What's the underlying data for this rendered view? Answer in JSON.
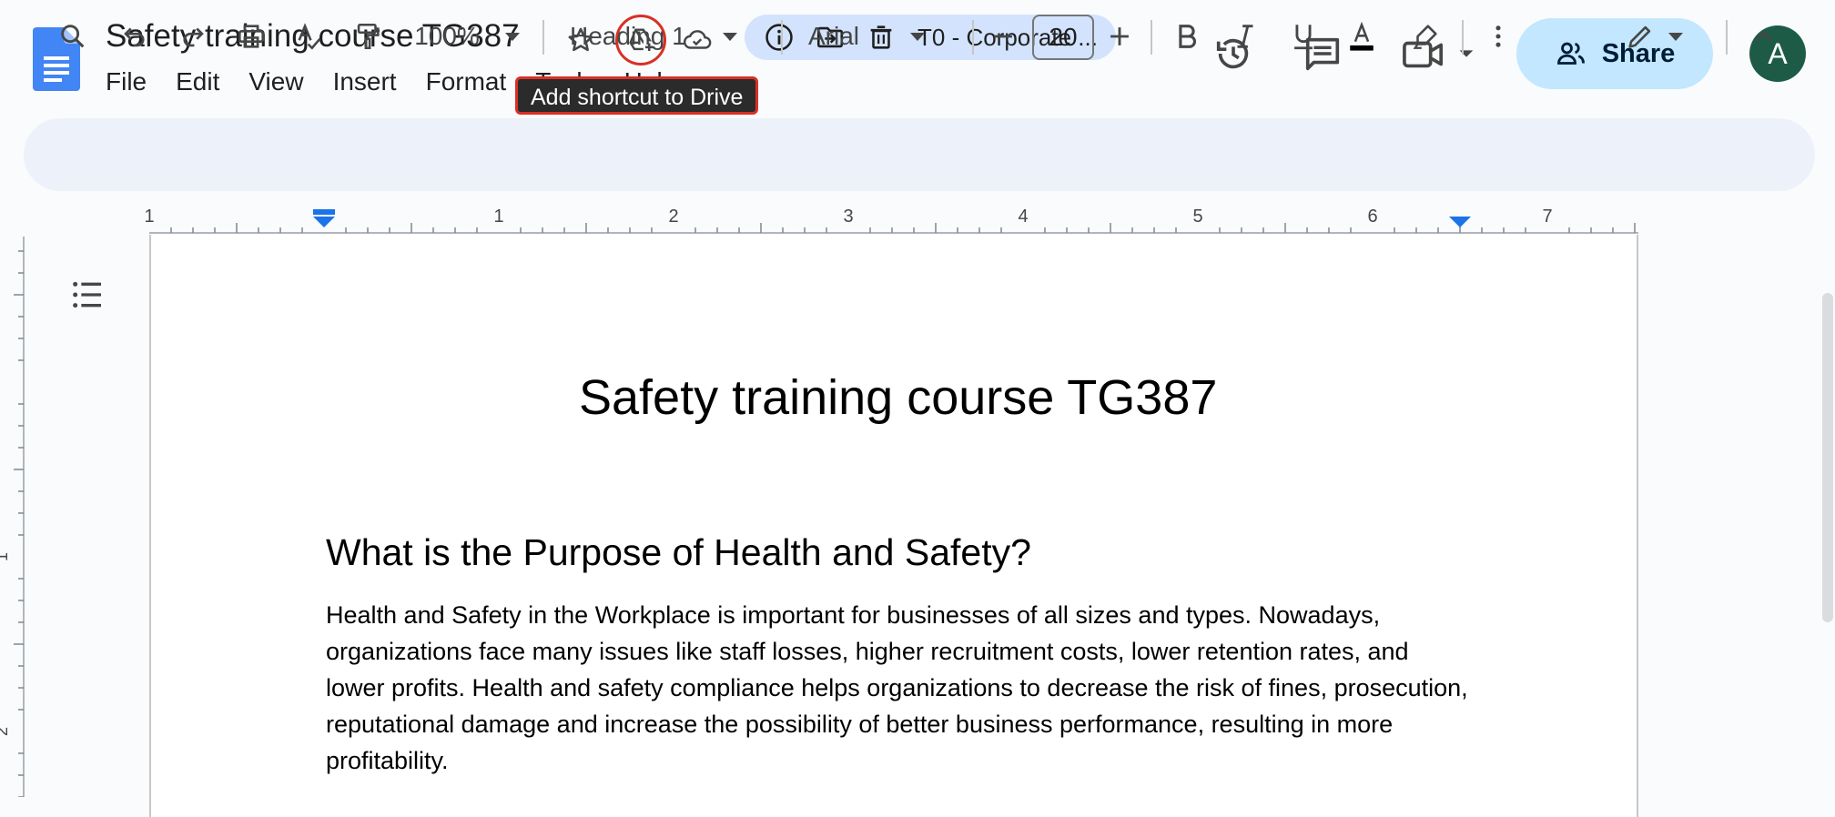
{
  "header": {
    "title": "Safety training course TG387",
    "location": "T0 - Corporate ...",
    "tooltip": "Add shortcut to Drive",
    "share_label": "Share",
    "avatar_initial": "A",
    "menu": [
      "File",
      "Edit",
      "View",
      "Insert",
      "Format",
      "Tools",
      "Help"
    ]
  },
  "toolbar": {
    "zoom": "100%",
    "style": "Heading 1",
    "font": "Arial",
    "font_size": "20"
  },
  "ruler": {
    "labels": [
      "1",
      "1",
      "2",
      "3",
      "4",
      "5",
      "6",
      "7"
    ]
  },
  "document": {
    "title": "Safety training course TG387",
    "heading": "What is the Purpose of Health and Safety?",
    "paragraph": "Health and Safety in the Workplace is important for businesses of all sizes and types. Nowadays, organizations face many issues like staff losses, higher recruitment costs, lower retention rates, and lower profits. Health and safety compliance helps organizations to decrease the risk of fines, prosecution, reputational damage and increase the possibility of better business performance, resulting in more profitability."
  },
  "colors": {
    "accent": "#1a73e8",
    "share_bg": "#c2e7ff",
    "pill_bg": "#d3e3fd",
    "highlight": "#d93025",
    "avatar_bg": "#1e5b47"
  },
  "icons": [
    "docs-logo-icon",
    "star-icon",
    "add-shortcut-icon",
    "cloud-saved-icon",
    "info-icon",
    "move-icon",
    "trash-icon",
    "history-icon",
    "comments-icon",
    "meet-icon",
    "share-people-icon",
    "search-icon",
    "undo-icon",
    "redo-icon",
    "print-icon",
    "spellcheck-icon",
    "paint-format-icon",
    "bold-icon",
    "italic-icon",
    "underline-icon",
    "text-color-icon",
    "highlight-icon",
    "more-icon",
    "edit-mode-icon",
    "collapse-icon",
    "outline-icon"
  ]
}
